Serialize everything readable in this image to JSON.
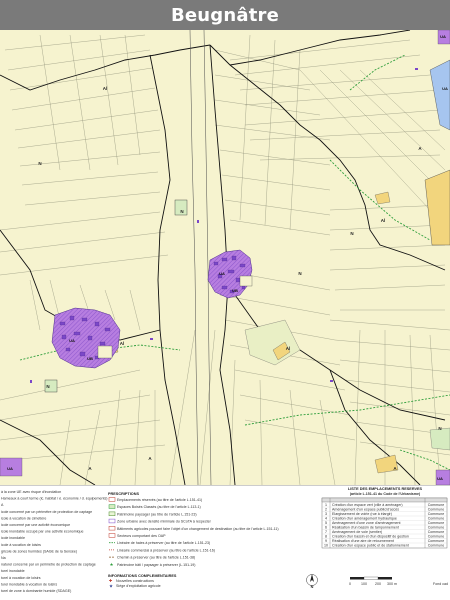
{
  "title": "Beugnâtre",
  "map": {
    "zone_labels": [
      "N",
      "N",
      "N",
      "Al",
      "Al",
      "Al",
      "N",
      "N",
      "A",
      "A",
      "A",
      "Al",
      "N",
      "A"
    ],
    "village_labels": [
      "UA",
      "UA",
      "UB",
      "UB"
    ],
    "edge_labels": [
      "UA",
      "UA",
      "UA",
      "UA"
    ]
  },
  "legend": {
    "left_items": [
      "à la zone UE avec risque d'inondation",
      "Hameaux à court terme (ic. habitat / é. économie / d. équipements)",
      "A",
      "icole concerné par un périmètre de protection de captage",
      "icole à vocation de cimetière",
      "icole concerné par une activité économique",
      "icole inondable occupé par une activité économique",
      "icole inondable",
      "icole à vocation de loisirs",
      "gricole de zones humides (SAGE de la Sensée)",
      "Na",
      "naturel concerné par un périmètre de protection de captage",
      "turel inondable",
      "turel à vocation de loisirs",
      "turel inondable à vocation de loisirs",
      "turel de zone à dominante humide (SDAGE)"
    ],
    "prescriptions_title": "PRESCRIPTIONS",
    "prescriptions": [
      "Emplacements réservés (au titre de l'article L.151-41)",
      "Espaces Boisés Classés (au titre de l'article L.113-1)",
      "Patrimoine paysager (au titre de l'article L.151-23)",
      "Zone urbaine avec densité minimale du SCoTA à respecter",
      "Bâtiments agricoles pouvant faire l'objet d'un changement de destination (au titre de l'article L.151-11)",
      "Secteurs comportant des OAP",
      "Linéaire de haies à préserver (au titre de l'article L.151-23)",
      "Linéaire commercial à préserver (au titre de l'article L.151-16)",
      "Chemin à préserver (au titre de l'article L.151-38)",
      "Patrimoine bâti / paysager à préserver (L.151-19)"
    ],
    "info_title": "INFORMATIONS COMPLEMENTAIRES",
    "info": [
      "Nouvelles constructions",
      "Siège d'exploitation agricole"
    ],
    "reserved_title": "LISTE DES EMPLACEMENTS RESERVES",
    "reserved_subtitle": "(article L.151-41 du Code de l'Urbanisme)",
    "reserved_rows": [
      {
        "no": "1",
        "objet": "Création d'un espace vert (ville à aménager)",
        "ben": "Commune"
      },
      {
        "no": "2",
        "objet": "Aménagement d'un espace public/d'accès",
        "ben": "Commune"
      },
      {
        "no": "3",
        "objet": "Elargissement de voirie (rue à élargir)",
        "ben": "Commune"
      },
      {
        "no": "4",
        "objet": "Création d'un aménagement hydraulique",
        "ben": "Commune"
      },
      {
        "no": "5",
        "objet": "Aménagement d'une zone d'aménagement",
        "ben": "Commune"
      },
      {
        "no": "6",
        "objet": "Réalisation d'un bassin de tamponnement",
        "ben": "Commune"
      },
      {
        "no": "7",
        "objet": "Aménagement de voie (sentier)",
        "ben": "Commune"
      },
      {
        "no": "8",
        "objet": "Création d'un bassin et d'un dispositif de gestion",
        "ben": "Commune"
      },
      {
        "no": "9",
        "objet": "Réalisation d'une aire de retournement",
        "ben": "Commune"
      },
      {
        "no": "10",
        "objet": "Création d'un espace public et de stationnement",
        "ben": "Commune"
      }
    ],
    "scale_labels": [
      "0",
      "100",
      "200",
      "300 m"
    ],
    "north_label": "N",
    "footer_note": "Fond cad"
  },
  "colors": {
    "agri": "#f6f3cf",
    "urban": "#b77ee0",
    "urban_dark": "#7b47c8",
    "zone_yellow": "#f2d57d",
    "zone_blue": "#a6c5ef",
    "zone_green": "#d6ebc0",
    "boundary": "#111111",
    "hedge": "#2f9e3c"
  }
}
